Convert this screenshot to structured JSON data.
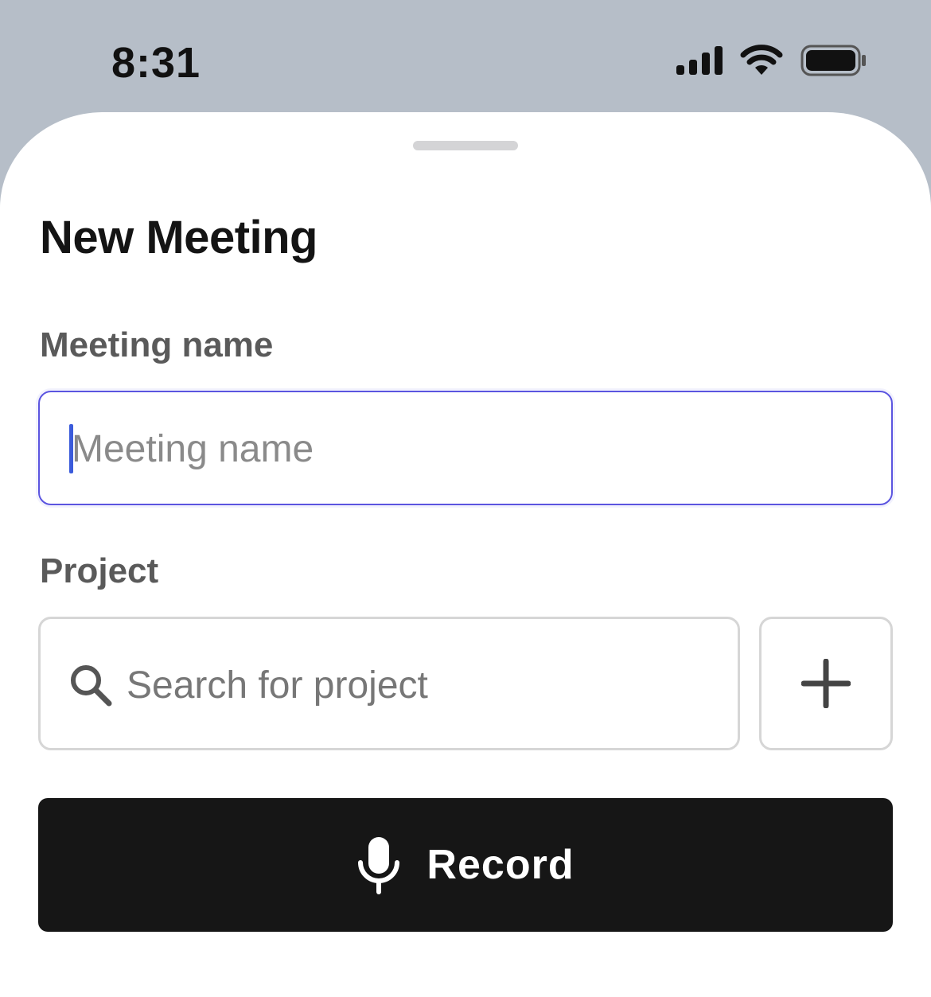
{
  "status_bar": {
    "time": "8:31",
    "icons": [
      "signal-icon",
      "wifi-icon",
      "battery-icon"
    ]
  },
  "sheet": {
    "title": "New Meeting",
    "meeting_name": {
      "label": "Meeting name",
      "placeholder": "Meeting name",
      "value": ""
    },
    "project": {
      "label": "Project",
      "search_placeholder": "Search for project",
      "search_icon": "search-icon",
      "add_icon": "plus-icon"
    },
    "record_button": {
      "label": "Record",
      "icon": "microphone-icon"
    }
  },
  "colors": {
    "backdrop": "#b6bec8",
    "focus_border": "#5b55e0",
    "caret": "#3b5bdb",
    "button_bg": "#161616"
  }
}
